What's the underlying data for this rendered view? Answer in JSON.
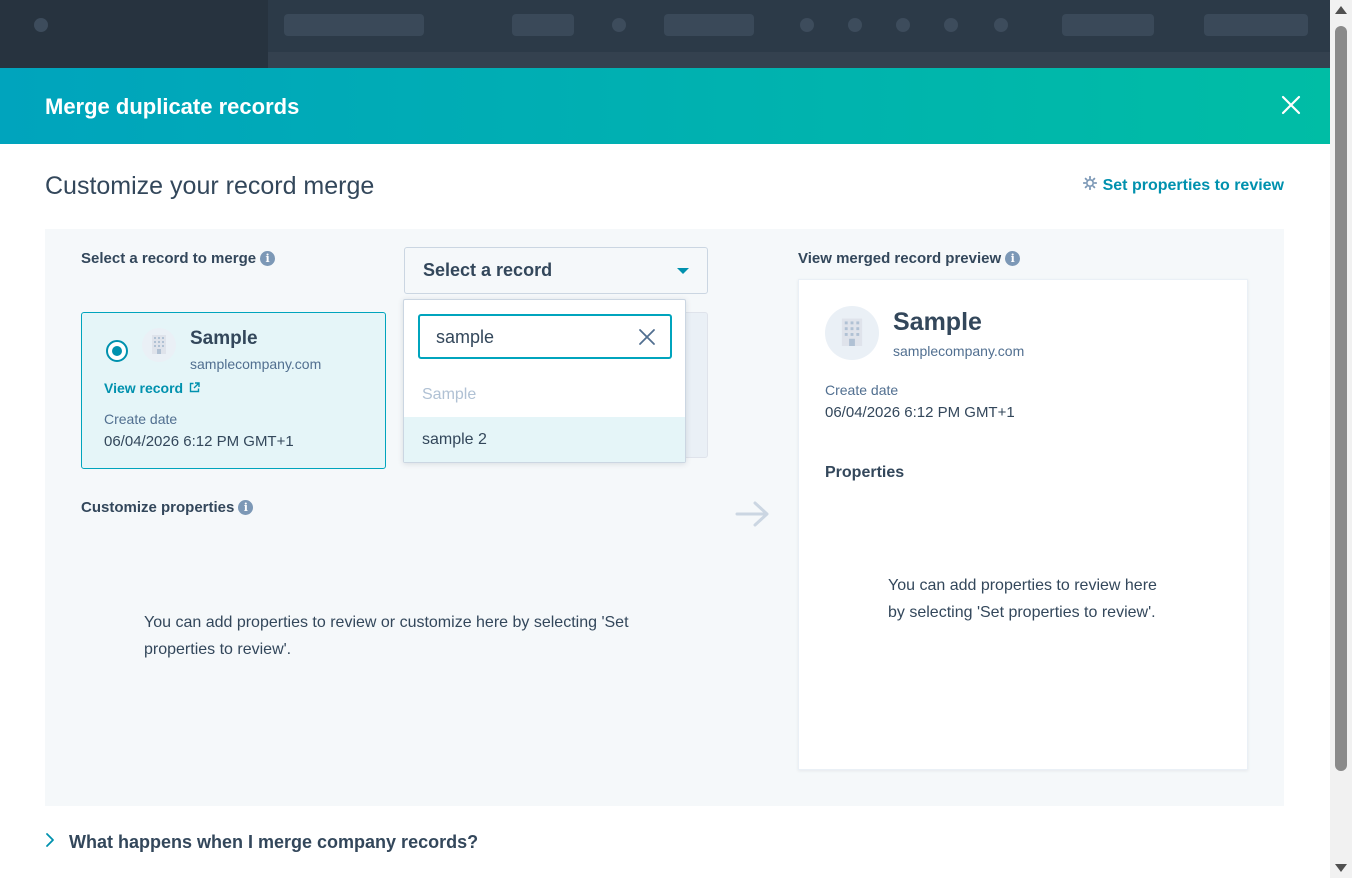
{
  "modal": {
    "title": "Merge duplicate records",
    "subtitle": "Customize your record merge",
    "set_properties_label": "Set properties to review"
  },
  "select_record": {
    "label": "Select a record to merge",
    "dropdown_label": "Select a record",
    "search_value": "sample",
    "options": [
      {
        "label": "Sample",
        "disabled": true
      },
      {
        "label": "sample 2",
        "disabled": false
      }
    ]
  },
  "primary_record": {
    "name": "Sample",
    "domain": "samplecompany.com",
    "view_label": "View record",
    "create_date_label": "Create date",
    "create_date": "06/04/2026 6:12 PM GMT+1"
  },
  "customize": {
    "label": "Customize properties",
    "empty_text": "You can add properties to review or customize here by selecting 'Set properties to review'."
  },
  "preview": {
    "label": "View merged record preview",
    "name": "Sample",
    "domain": "samplecompany.com",
    "create_date_label": "Create date",
    "create_date": "06/04/2026 6:12 PM GMT+1",
    "properties_label": "Properties",
    "empty_text": "You can add properties to review here by selecting 'Set properties to review'."
  },
  "faq": {
    "label": "What happens when I merge company records?"
  },
  "colors": {
    "accent": "#0091ae",
    "header_start": "#00a4bd",
    "header_end": "#00bda5",
    "text": "#33475b"
  }
}
